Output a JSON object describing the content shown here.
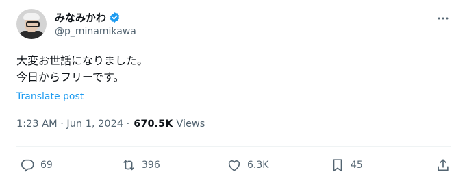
{
  "author": {
    "display_name": "みなみかわ",
    "handle": "@p_minamikawa",
    "verified": true
  },
  "post": {
    "lines": [
      "大変お世話になりました。",
      "今日からフリーです。"
    ],
    "translate_label": "Translate post"
  },
  "meta": {
    "timestamp": "1:23 AM · Jun 1, 2024 ·",
    "views_count": "670.5K",
    "views_label": "Views"
  },
  "actions": {
    "replies": "69",
    "reposts": "396",
    "likes": "6.3K",
    "bookmarks": "45"
  },
  "colors": {
    "accent": "#1d9bf0",
    "text": "#0f1419",
    "muted": "#536471"
  },
  "icons": [
    "more-icon",
    "verified-icon",
    "reply-icon",
    "repost-icon",
    "like-icon",
    "bookmark-icon",
    "share-icon"
  ]
}
